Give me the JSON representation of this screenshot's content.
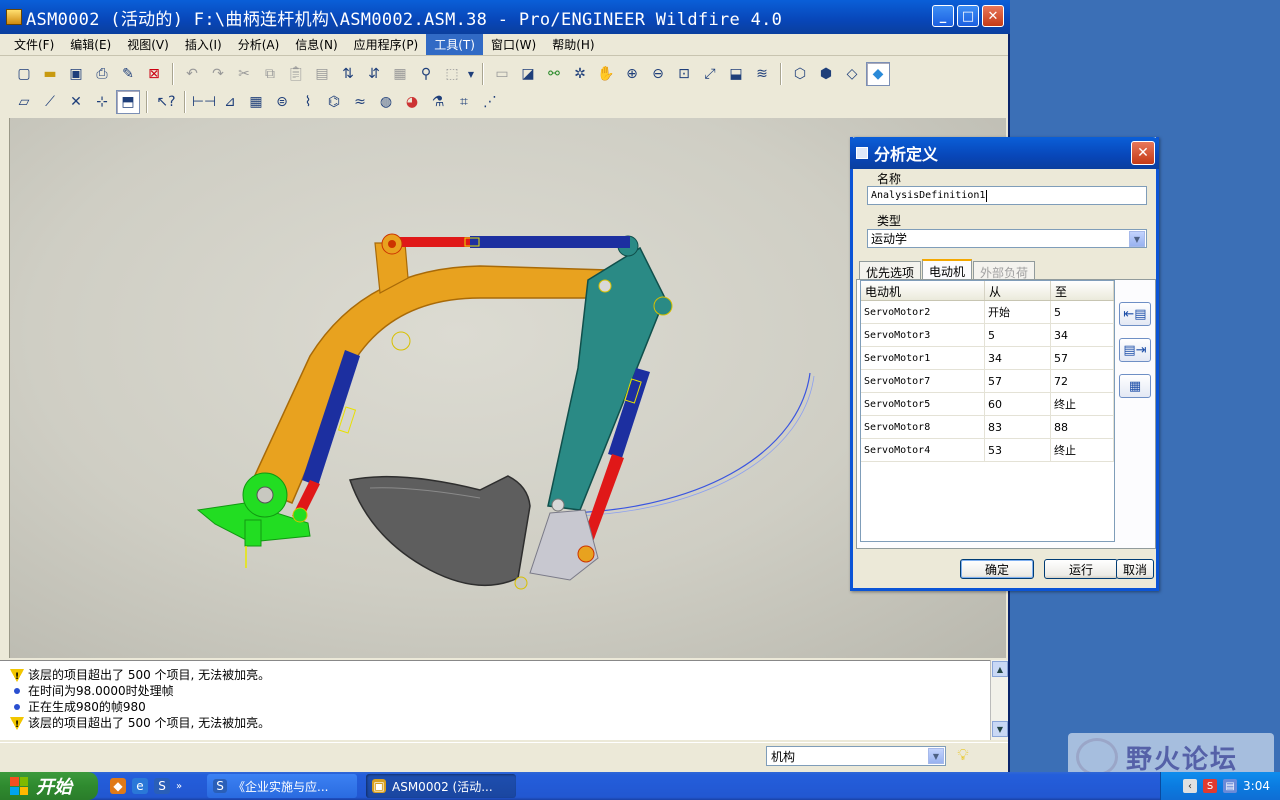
{
  "window": {
    "title": "ASM0002 (活动的) F:\\曲柄连杆机构\\ASM0002.ASM.38 - Pro/ENGINEER Wildfire 4.0",
    "minimize": "_",
    "maximize": "□",
    "close": "✕"
  },
  "menubar": {
    "items": [
      "文件(F)",
      "编辑(E)",
      "视图(V)",
      "插入(I)",
      "分析(A)",
      "信息(N)",
      "应用程序(P)",
      "工具(T)",
      "窗口(W)",
      "帮助(H)"
    ],
    "active": "工具(T)"
  },
  "messages": [
    {
      "type": "warning",
      "text": "该层的项目超出了 500 个项目, 无法被加亮。"
    },
    {
      "type": "info",
      "text": "在时间为98.0000时处理帧"
    },
    {
      "type": "info",
      "text": "正在生成980的帧980"
    },
    {
      "type": "warning",
      "text": "该层的项目超出了 500 个项目, 无法被加亮。"
    }
  ],
  "status": {
    "filter_value": "机构"
  },
  "dialog": {
    "title": "分析定义",
    "name_label": "名称",
    "name_value": "AnalysisDefinition1",
    "type_label": "类型",
    "type_value": "运动学",
    "tabs": [
      "优先选项",
      "电动机",
      "外部负荷"
    ],
    "selected_tab": "电动机",
    "table": {
      "headers": [
        "电动机",
        "从",
        "至"
      ],
      "rows": [
        {
          "motor": "ServoMotor2",
          "from": "开始",
          "to": "5"
        },
        {
          "motor": "ServoMotor3",
          "from": "5",
          "to": "34"
        },
        {
          "motor": "ServoMotor1",
          "from": "34",
          "to": "57"
        },
        {
          "motor": "ServoMotor7",
          "from": "57",
          "to": "72"
        },
        {
          "motor": "ServoMotor5",
          "from": "60",
          "to": "终止"
        },
        {
          "motor": "ServoMotor8",
          "from": "83",
          "to": "88"
        },
        {
          "motor": "ServoMotor4",
          "from": "53",
          "to": "终止"
        }
      ]
    },
    "buttons": {
      "ok": "确定",
      "run": "运行",
      "cancel": "取消"
    }
  },
  "taskbar": {
    "start_label": "开始",
    "tasks": [
      "《企业实施与应...",
      "ASM0002 (活动..."
    ],
    "clock": "3:04"
  },
  "watermark": {
    "text": "野火论坛"
  },
  "colors": {
    "xp_blue": "#0a5fd8",
    "boom": "#e8a21f",
    "stick": "#2a8a85",
    "cylinder_rod": "#e01818",
    "cylinder_body": "#1c2fa0",
    "bucket": "#5e5e5e",
    "base": "#22dd22"
  }
}
